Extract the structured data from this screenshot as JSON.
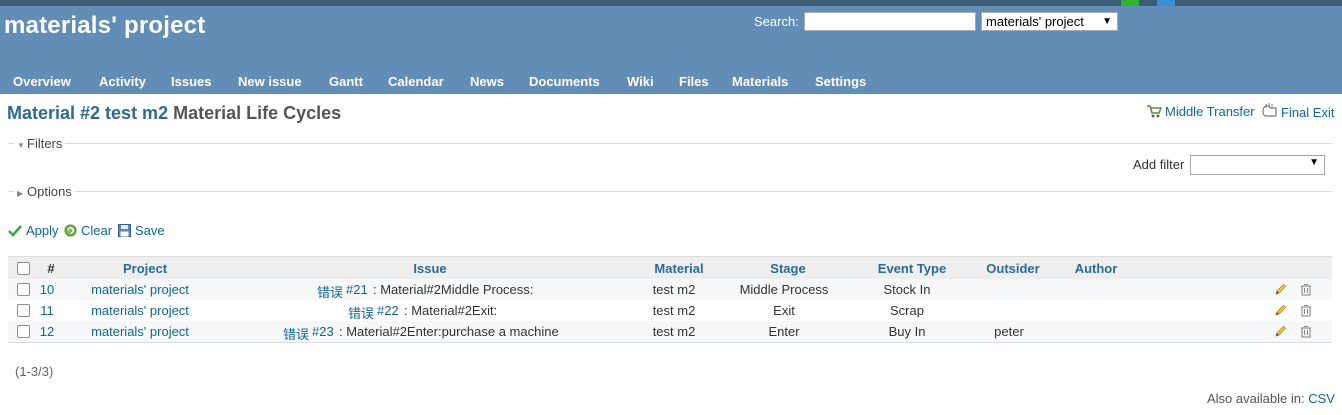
{
  "header": {
    "project_title": "materials' project",
    "search_label": "Search:",
    "search_value": "",
    "project_select": "materials' project"
  },
  "menu": [
    {
      "label": "Overview"
    },
    {
      "label": "Activity"
    },
    {
      "label": "Issues"
    },
    {
      "label": "New issue"
    },
    {
      "label": "Gantt"
    },
    {
      "label": "Calendar"
    },
    {
      "label": "News"
    },
    {
      "label": "Documents"
    },
    {
      "label": "Wiki"
    },
    {
      "label": "Files"
    },
    {
      "label": "Materials"
    },
    {
      "label": "Settings"
    }
  ],
  "page": {
    "title_link": "Material #2 test m2",
    "title_rest": "Material Life Cycles",
    "middle_transfer": "Middle Transfer",
    "final_exit": "Final Exit"
  },
  "filters": {
    "filters_legend": "Filters",
    "add_filter_label": "Add filter",
    "options_legend": "Options"
  },
  "actions": {
    "apply": "Apply",
    "clear": "Clear",
    "save": "Save"
  },
  "table": {
    "headers": [
      "#",
      "Project",
      "Issue",
      "Material",
      "Stage",
      "Event Type",
      "Outsider",
      "Author"
    ],
    "rows": [
      {
        "id": "10",
        "project": "materials' project",
        "issue_tracker": "错误",
        "issue_link": "#21",
        "issue_text": ": Material#2Middle Process:",
        "material": "test m2",
        "stage": "Middle Process",
        "event_type": "Stock In",
        "outsider": "",
        "author": ""
      },
      {
        "id": "11",
        "project": "materials' project",
        "issue_tracker": "错误",
        "issue_link": "#22",
        "issue_text": ": Material#2Exit:",
        "material": "test m2",
        "stage": "Exit",
        "event_type": "Scrap",
        "outsider": "",
        "author": ""
      },
      {
        "id": "12",
        "project": "materials' project",
        "issue_tracker": "错误",
        "issue_link": "#23",
        "issue_text": ": Material#2Enter:purchase a machine",
        "material": "test m2",
        "stage": "Enter",
        "event_type": "Buy In",
        "outsider": "peter",
        "author": ""
      }
    ]
  },
  "footer": {
    "count": "(1-3/3)",
    "also_available": "Also available in:",
    "csv": "CSV"
  },
  "colors": {
    "header_bg": "#628db6",
    "top_strip": "#3e5b76",
    "link": "#169"
  }
}
